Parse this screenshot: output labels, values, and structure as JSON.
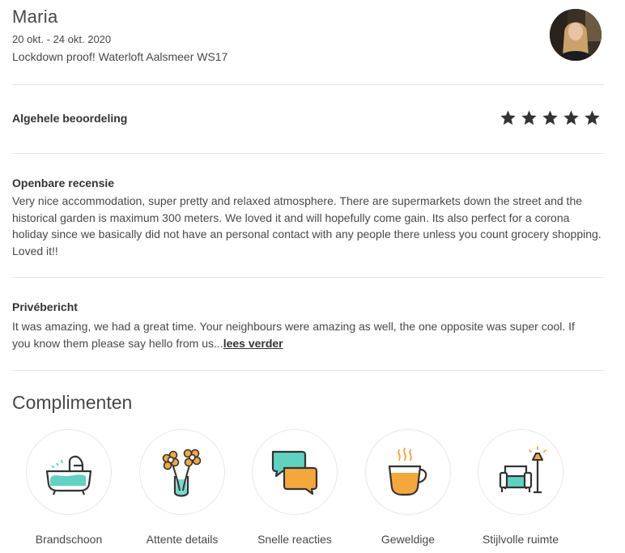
{
  "review": {
    "guest_name": "Maria",
    "dates": "20 okt. - 24 okt. 2020",
    "listing_title": "Lockdown proof! Waterloft Aalsmeer WS17"
  },
  "rating": {
    "label": "Algehele beoordeling",
    "stars": 5,
    "max_stars": 5
  },
  "public_review": {
    "title": "Openbare recensie",
    "text": "Very nice accommodation, super pretty and relaxed atmosphere. There are supermarkets down the street and the historical garden is maximum 300 meters. We loved it and will hopefully come gain. Its also perfect for a corona holiday since we basically did not have an personal contact with any people there unless you count grocery shopping. Loved it!!"
  },
  "private_message": {
    "title": "Privébericht",
    "text": "It was amazing, we had a great time. Your neighbours were amazing as well, the one opposite was super cool. If you know them please say hello from us...",
    "read_more": "lees verder"
  },
  "compliments": {
    "title": "Complimenten",
    "items": [
      {
        "label": "Brandschoon",
        "icon": "bathtub-icon"
      },
      {
        "label": "Attente details",
        "icon": "flowers-icon"
      },
      {
        "label": "Snelle reacties",
        "icon": "chat-bubbles-icon"
      },
      {
        "label": "Geweldige",
        "icon": "coffee-cup-icon"
      },
      {
        "label": "Stijlvolle ruimte",
        "icon": "armchair-lamp-icon"
      }
    ]
  },
  "colors": {
    "teal": "#5fd3c0",
    "orange": "#f5a83a",
    "text": "#484848",
    "divider": "#e4e4e4"
  }
}
